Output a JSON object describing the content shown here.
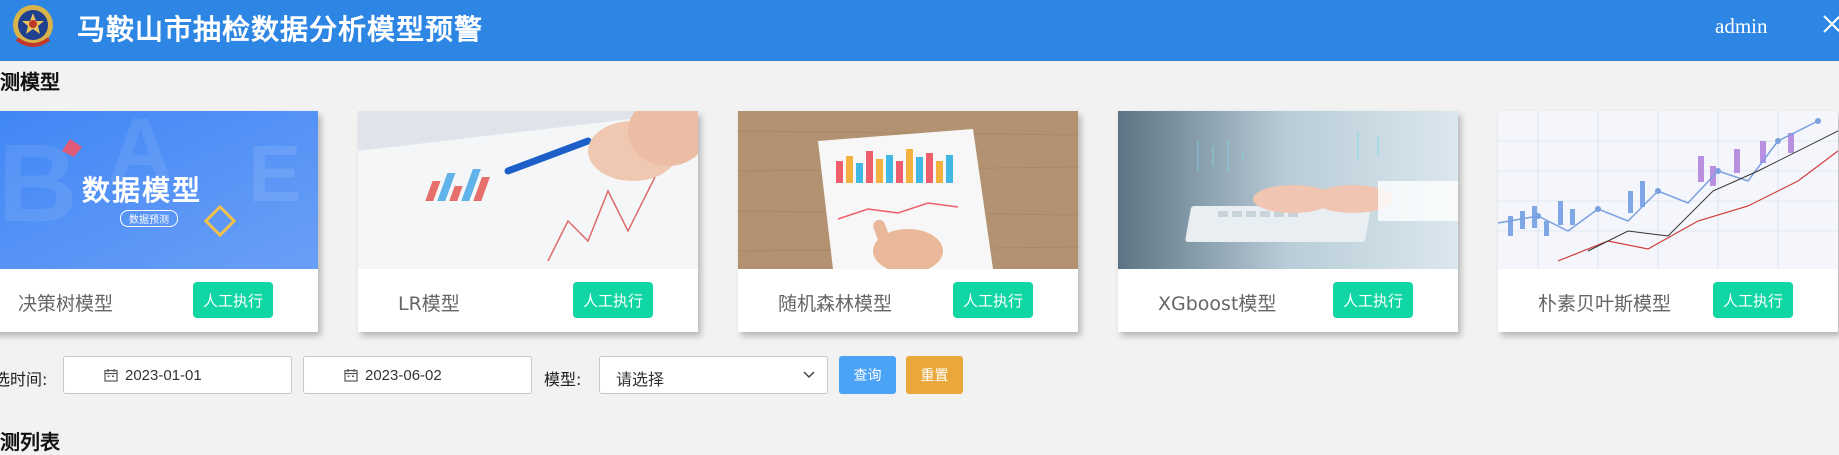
{
  "header": {
    "title": "马鞍山市抽检数据分析模型预警",
    "user": "admin",
    "emblem_icon": "police-emblem-icon",
    "close_icon": "close-icon",
    "bg_color": "#2d86e3"
  },
  "section_title": "测模型",
  "cards": [
    {
      "name": "决策树模型",
      "button": "人工执行",
      "banner_text": "数据模型",
      "banner_sub": "数据预测"
    },
    {
      "name": "LR模型",
      "button": "人工执行"
    },
    {
      "name": "随机森林模型",
      "button": "人工执行"
    },
    {
      "name": "XGboost模型",
      "button": "人工执行"
    },
    {
      "name": "朴素贝叶斯模型",
      "button": "人工执行"
    }
  ],
  "filters": {
    "time_label": "选时间:",
    "start_date": "2023-01-01",
    "end_date": "2023-06-02",
    "model_label": "模型:",
    "model_select": "请选择",
    "query": "查询",
    "reset": "重置"
  },
  "list_title": "测列表",
  "colors": {
    "exec_button": "#0fd6a2",
    "query_button": "#4aa3f7",
    "reset_button": "#eaa83a"
  }
}
